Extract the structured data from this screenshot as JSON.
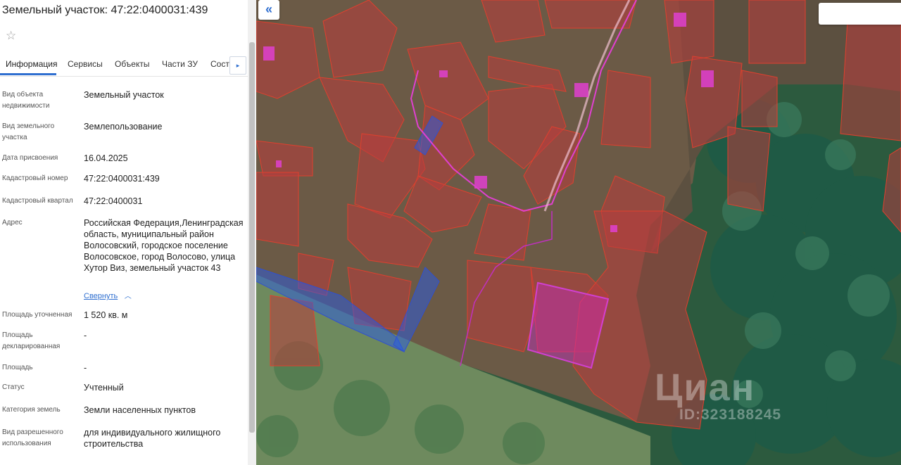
{
  "header": {
    "title": "Земельный участок: 47:22:0400031:439"
  },
  "tabs": [
    {
      "label": "Информация"
    },
    {
      "label": "Сервисы"
    },
    {
      "label": "Объекты"
    },
    {
      "label": "Части ЗУ"
    },
    {
      "label": "Соста"
    }
  ],
  "tab_next_icon": "▸",
  "fields": [
    {
      "label": "Вид объекта недвижимости",
      "value": "Земельный участок"
    },
    {
      "label": "Вид земельного участка",
      "value": "Землепользование"
    },
    {
      "label": "Дата присвоения",
      "value": "16.04.2025"
    },
    {
      "label": "Кадастровый номер",
      "value": "47:22:0400031:439"
    },
    {
      "label": "Кадастровый квартал",
      "value": "47:22:0400031"
    },
    {
      "label": "Адрес",
      "value": "Российская Федерация,Ленинградская область, муниципальный район Волосовский, городское поселение Волосовское, город Волосово, улица Хутор Виз, земельный участок 43"
    },
    {
      "label": "Площадь уточненная",
      "value": "1 520 кв. м"
    },
    {
      "label": "Площадь декларированная",
      "value": "-"
    },
    {
      "label": "Площадь",
      "value": "-"
    },
    {
      "label": "Статус",
      "value": "Учтенный"
    },
    {
      "label": "Категория земель",
      "value": "Земли населенных пунктов"
    },
    {
      "label": "Вид разрешенного использования",
      "value": "для индивидуального жилищного строительства"
    }
  ],
  "collapse_link": "Свернуть",
  "collapse_button_icon": "«",
  "watermark": {
    "brand": "Циан",
    "id": "ID:323188245"
  },
  "colors": {
    "accent": "#2f6fd0",
    "parcel_fill": "rgba(185,60,60,0.55)",
    "parcel_stroke": "#e0402e",
    "selected_parcel": "rgba(200,40,200,0.45)",
    "building": "#e040d0",
    "water_zone": "rgba(40,90,230,0.45)"
  }
}
